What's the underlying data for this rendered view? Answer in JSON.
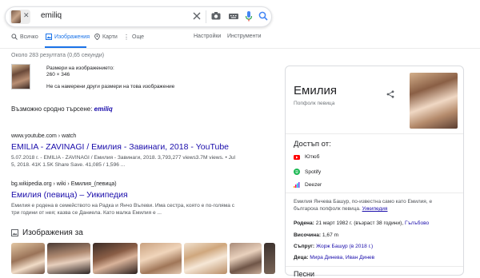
{
  "search": {
    "query": "emiliq"
  },
  "tabs": {
    "all": "Всичко",
    "images": "Изображения",
    "maps": "Карти",
    "more": "Още",
    "settings": "Настройки",
    "tools": "Инструменти"
  },
  "stats": "Около 283 резултата (0,65 секунди)",
  "image_info": {
    "size_label": "Размери на изображението:",
    "size_value": "260 × 346",
    "no_other_sizes": "Не са намерени други размери на това изображение"
  },
  "related": {
    "label": "Възможно сродно търсене:",
    "term": "emiliq"
  },
  "results": [
    {
      "url": "www.youtube.com › watch",
      "title": "EMILIA - ZAVINAGI / Емилия - Завинаги, 2018 - YouTube",
      "snippet_1": "5.07.2018 г. - EMILIA - ZAVINAGI / Емилия - Завинаги, 2018. 3,793,277 views3.7M views. • Jul",
      "snippet_2": "5, 2018. 41K 1.5K Share Save. 41,085 / 1,596 ..."
    },
    {
      "url": "bg.wikipedia.org › wiki › Емилия_(певица)",
      "title": "Емилия (певица) – Уикипедия",
      "snippet_1": "Емилия е родена в семейството на Радка и Янчо Вълеви. Има сестра, която е по-голяма с",
      "snippet_2": "три години от нея; казва се Даниела. Като малка Емилия е ..."
    }
  ],
  "images_section": {
    "title": "Изображения за"
  },
  "knowledge_panel": {
    "name": "Емилия",
    "subtitle": "Попфолк певица",
    "access_title": "Достъп от:",
    "services": [
      "Ютюб",
      "Spotify",
      "Deezer"
    ],
    "description": "Емилия Янчева Башур, по-известна само като Емилия, е българска попфолк певица.",
    "description_link": "Уикипедия",
    "born_label": "Родена:",
    "born_value": "21 март 1982 г. (възраст 38 години),",
    "born_place": "Гълъбово",
    "height_label": "Височина:",
    "height_value": "1,67 m",
    "spouse_label": "Съпруг:",
    "spouse_value": "Жорж Башур (в 2018 г.)",
    "children_label": "Деца:",
    "children_value": "Мира Динева, Иван Динев",
    "next_heading": "Песни"
  },
  "colors": {
    "link": "#1a0dab",
    "accent": "#1a73e8",
    "youtube_red": "#ff0000",
    "spotify_green": "#1db954"
  }
}
